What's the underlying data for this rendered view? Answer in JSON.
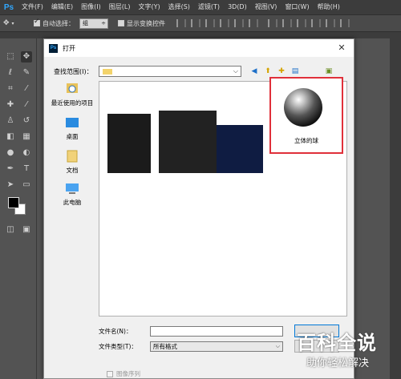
{
  "app": {
    "logo": "Ps",
    "menu": [
      "文件(F)",
      "编辑(E)",
      "图像(I)",
      "图层(L)",
      "文字(Y)",
      "选择(S)",
      "滤镜(T)",
      "3D(D)",
      "视图(V)",
      "窗口(W)",
      "帮助(H)"
    ]
  },
  "options_bar": {
    "auto_select_label": "自动选择：",
    "auto_select_checked": true,
    "auto_select_value": "组",
    "transform_label": "显示变换控件",
    "transform_checked": false
  },
  "toolbar": {
    "foreground_color": "#000000",
    "background_color": "#ffffff"
  },
  "dialog": {
    "title": "打开",
    "close_icon": "close-icon",
    "look_in_label": "查找范围(I)：",
    "places": [
      {
        "label": "最近使用的项目",
        "icon": "recent-icon"
      },
      {
        "label": "桌面",
        "icon": "desktop-icon"
      },
      {
        "label": "文档",
        "icon": "documents-icon"
      },
      {
        "label": "此电脑",
        "icon": "computer-icon"
      }
    ],
    "selected_file": {
      "name": "立体的球",
      "highlight_color": "#e0303a"
    },
    "filename_label": "文件名(N)：",
    "filename_value": "",
    "filetype_label": "文件类型(T)：",
    "filetype_value": "所有格式",
    "image_sequence_label": "图像序列",
    "image_sequence_checked": false
  },
  "watermark": {
    "title": "百科全说",
    "subtitle": "助你轻松解决"
  }
}
